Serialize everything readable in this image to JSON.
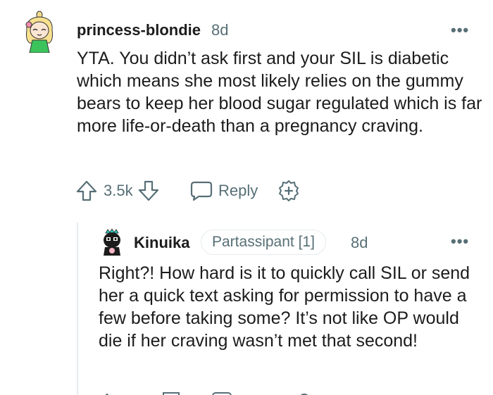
{
  "comment": {
    "username": "princess-blondie",
    "age": "8d",
    "text": "YTA. You didn’t ask first and your SIL is diabetic which means she most likely relies on the gummy bears to keep her blood sugar regulated which is far more life-or-death than a pregnancy craving.",
    "score": "3.5k",
    "reply_label": "Reply",
    "more_label": "•••"
  },
  "reply": {
    "username": "Kinuika",
    "flair": "Partassipant [1]",
    "age": "8d",
    "text": "Right?! How hard is it to quickly call SIL or send her a quick text asking for permission to have a few before taking some? It’s not like OP would die if her craving wasn’t met that second!",
    "more_label": "•••"
  }
}
